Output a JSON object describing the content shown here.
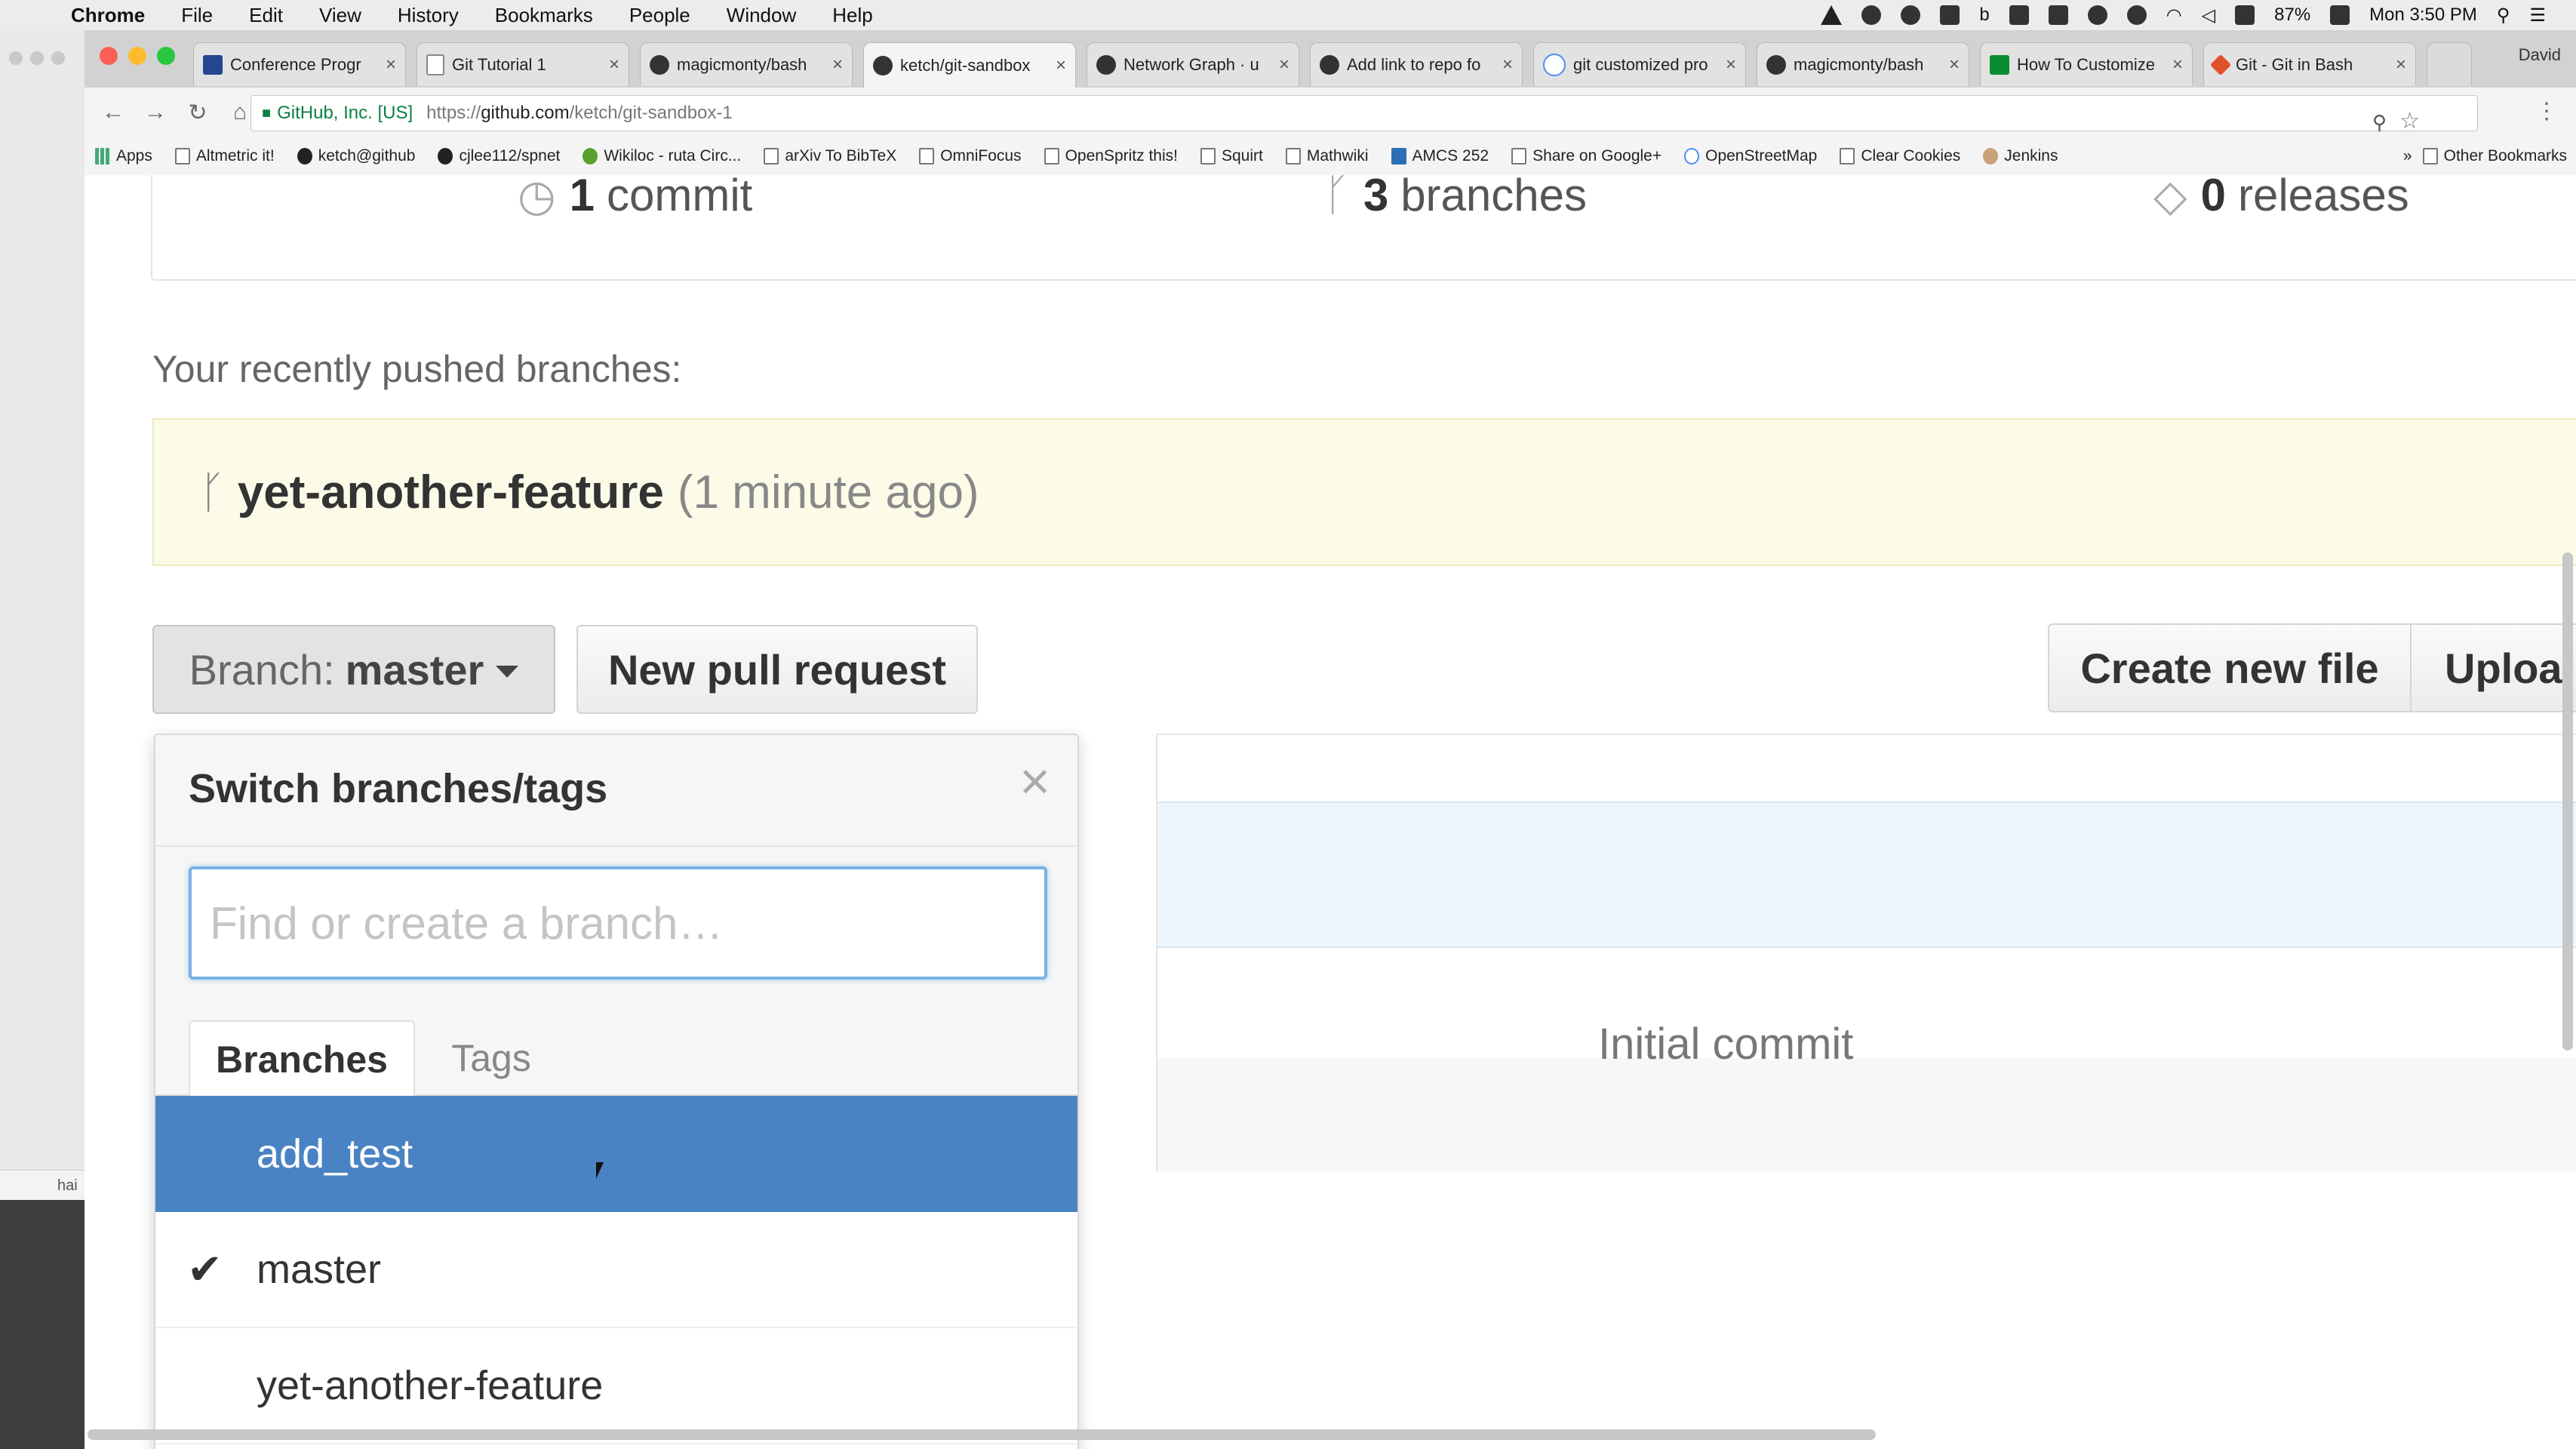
{
  "menubar": {
    "app": "Chrome",
    "items": [
      "File",
      "Edit",
      "View",
      "History",
      "Bookmarks",
      "People",
      "Window",
      "Help"
    ],
    "battery": "87%",
    "clock": "Mon 3:50 PM"
  },
  "desktop_stub": "hai",
  "tabs": [
    {
      "label": "Conference Progr"
    },
    {
      "label": "Git Tutorial 1"
    },
    {
      "label": "magicmonty/bash"
    },
    {
      "label": "ketch/git-sandbox"
    },
    {
      "label": "Network Graph · u"
    },
    {
      "label": "Add link to repo fo"
    },
    {
      "label": "git customized pro"
    },
    {
      "label": "magicmonty/bash"
    },
    {
      "label": "How To Customize"
    },
    {
      "label": "Git - Git in Bash"
    }
  ],
  "profile": "David",
  "omnibox": {
    "ev": "GitHub, Inc. [US]",
    "url_prefix": "https://",
    "url_host": "github.com",
    "url_path": "/ketch/git-sandbox-1"
  },
  "bookmarks": [
    "Apps",
    "Altmetric it!",
    "ketch@github",
    "cjlee112/spnet",
    "Wikiloc - ruta Circ...",
    "arXiv To BibTeX",
    "OmniFocus",
    "OpenSpritz this!",
    "Squirt",
    "Mathwiki",
    "AMCS 252",
    "Share on Google+",
    "OpenStreetMap",
    "Clear Cookies",
    "Jenkins"
  ],
  "bookmarks_other": "Other Bookmarks",
  "repo": {
    "commits_count": "1",
    "commits_label": "commit",
    "branches_count": "3",
    "branches_label": "branches",
    "releases_count": "0",
    "releases_label": "releases",
    "recent_label": "Your recently pushed branches:",
    "recent_branch": "yet-another-feature",
    "recent_ago": "(1 minute ago)",
    "branch_label": "Branch:",
    "branch_value": "master",
    "new_pr": "New pull request",
    "create_file": "Create new file",
    "upload": "Uploa",
    "commit_message": "Initial commit"
  },
  "dropdown": {
    "title": "Switch branches/tags",
    "placeholder": "Find or create a branch…",
    "tab_branches": "Branches",
    "tab_tags": "Tags",
    "items": [
      {
        "name": "add_test",
        "selected": true,
        "checked": false
      },
      {
        "name": "master",
        "selected": false,
        "checked": true
      },
      {
        "name": "yet-another-feature",
        "selected": false,
        "checked": false
      }
    ]
  }
}
